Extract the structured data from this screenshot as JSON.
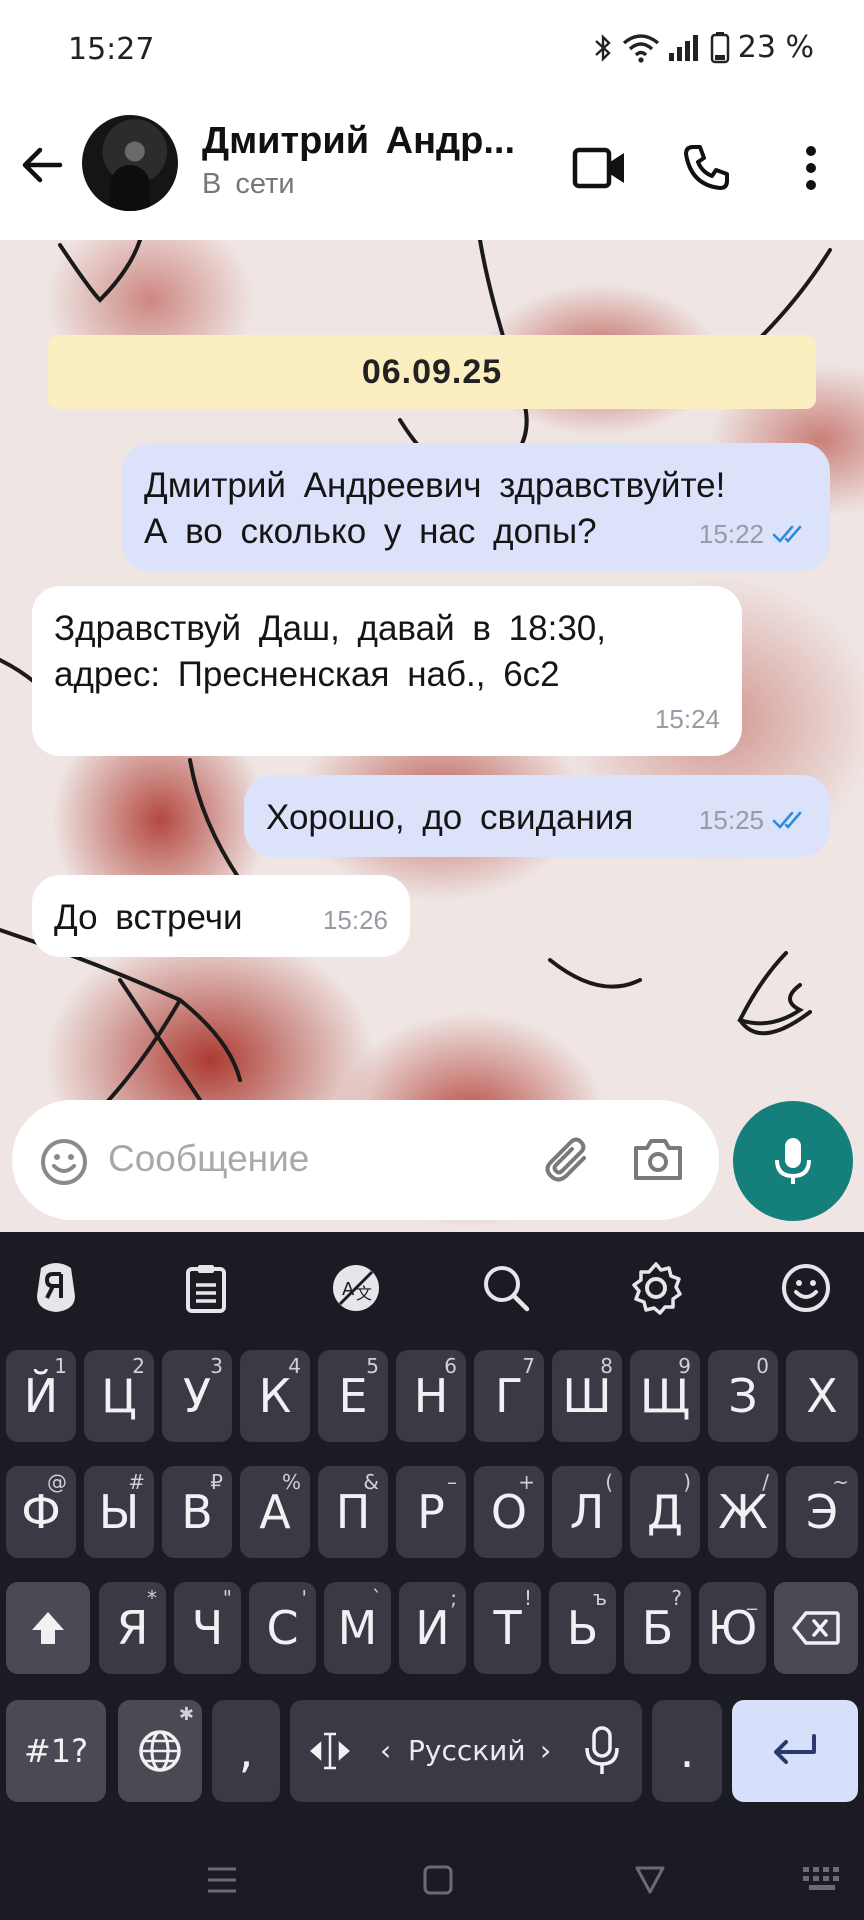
{
  "status_bar": {
    "time": "15:27",
    "battery": "23 %",
    "icons": [
      "bluetooth-icon",
      "wifi-icon",
      "signal-icon",
      "battery-icon"
    ]
  },
  "header": {
    "contact_name": "Дмитрий Андр...",
    "contact_status": "В сети",
    "icons": [
      "back-arrow-icon",
      "video-call-icon",
      "phone-icon",
      "more-vertical-icon"
    ]
  },
  "chat": {
    "date_chip": "06.09.25",
    "messages": [
      {
        "direction": "out",
        "lines": [
          "Дмитрий Андреевич здравствуйте!",
          "А во сколько у нас допы?"
        ],
        "time": "15:22",
        "read": true
      },
      {
        "direction": "in",
        "lines": [
          "Здравствуй Даш, давай в 18:30,",
          "адрес: Пресненская наб., 6с2"
        ],
        "time": "15:24"
      },
      {
        "direction": "out",
        "lines": [
          "Хорошо, до свидания"
        ],
        "time": "15:25",
        "read": true
      },
      {
        "direction": "in",
        "lines": [
          "До встречи"
        ],
        "time": "15:26"
      }
    ],
    "read_color": "#2f8bd8"
  },
  "composer": {
    "placeholder": "Сообщение",
    "icons": [
      "emoji-icon",
      "attach-icon",
      "camera-icon",
      "microphone-icon"
    ],
    "fab_color": "#147f7b"
  },
  "keyboard": {
    "toolbar_icons": [
      "yandex-mitten-icon",
      "clipboard-icon",
      "translate-icon",
      "search-icon",
      "settings-icon",
      "emoji-icon"
    ],
    "row1": [
      {
        "label": "Й",
        "hint": "1"
      },
      {
        "label": "Ц",
        "hint": "2"
      },
      {
        "label": "У",
        "hint": "3"
      },
      {
        "label": "К",
        "hint": "4"
      },
      {
        "label": "Е",
        "hint": "5"
      },
      {
        "label": "Н",
        "hint": "6"
      },
      {
        "label": "Г",
        "hint": "7"
      },
      {
        "label": "Ш",
        "hint": "8"
      },
      {
        "label": "Щ",
        "hint": "9"
      },
      {
        "label": "З",
        "hint": "0"
      },
      {
        "label": "Х",
        "hint": ""
      }
    ],
    "row2": [
      {
        "label": "Ф",
        "hint": "@"
      },
      {
        "label": "Ы",
        "hint": "#"
      },
      {
        "label": "В",
        "hint": "₽"
      },
      {
        "label": "А",
        "hint": "%"
      },
      {
        "label": "П",
        "hint": "&"
      },
      {
        "label": "Р",
        "hint": "–"
      },
      {
        "label": "О",
        "hint": "+"
      },
      {
        "label": "Л",
        "hint": "("
      },
      {
        "label": "Д",
        "hint": ")"
      },
      {
        "label": "Ж",
        "hint": "/"
      },
      {
        "label": "Э",
        "hint": "~"
      }
    ],
    "row3": [
      {
        "label": "Я",
        "hint": "*"
      },
      {
        "label": "Ч",
        "hint": "\""
      },
      {
        "label": "С",
        "hint": "'"
      },
      {
        "label": "М",
        "hint": "`"
      },
      {
        "label": "И",
        "hint": ";"
      },
      {
        "label": "Т",
        "hint": "!"
      },
      {
        "label": "Ь",
        "hint": "ъ"
      },
      {
        "label": "Б",
        "hint": "?"
      },
      {
        "label": "Ю",
        "hint": "_"
      }
    ],
    "symbols_key": "#1?",
    "comma": ",",
    "period": ".",
    "language": "Русский",
    "lang_prev": "‹",
    "lang_next": "›",
    "enter_color": "#d7e0fb"
  },
  "navbar": {
    "icons": [
      "menu-icon",
      "home-icon",
      "back-icon",
      "keyboard-hide-icon"
    ]
  }
}
